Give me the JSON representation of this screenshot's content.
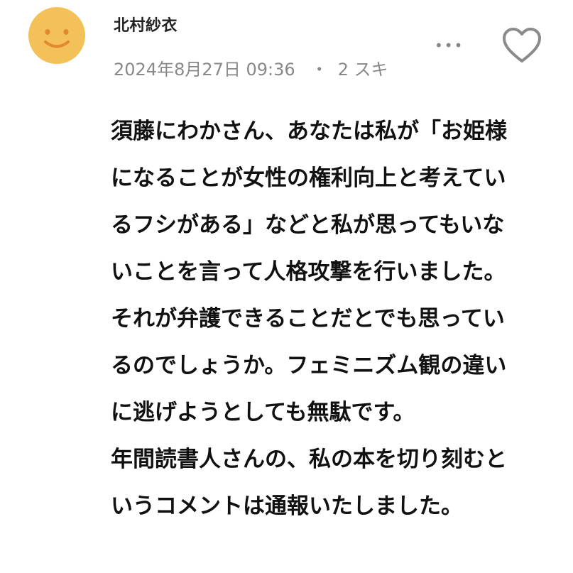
{
  "comment": {
    "author": "北村紗衣",
    "date": "2024年8月27日 09:36",
    "separator": "・",
    "likes": "2 スキ",
    "more_icon": "more-dots-icon",
    "like_icon": "heart-icon",
    "avatar_icon": "smiley-face-icon",
    "avatar_color": "#f3c158",
    "lines": [
      "須藤にわかさん、あなたは私が「お姫様",
      "になることが女性の権利向上と考えてい",
      "るフシがある」などと私が思ってもいな",
      "いことを言って人格攻撃を行いました。",
      "それが弁護できることだとでも思ってい",
      "るのでしょうか。フェミニズム観の違い",
      "に逃げようとしても無駄です。",
      "年間読書人さんの、私の本を切り刻むと",
      "いうコメントは通報いたしました。"
    ]
  }
}
